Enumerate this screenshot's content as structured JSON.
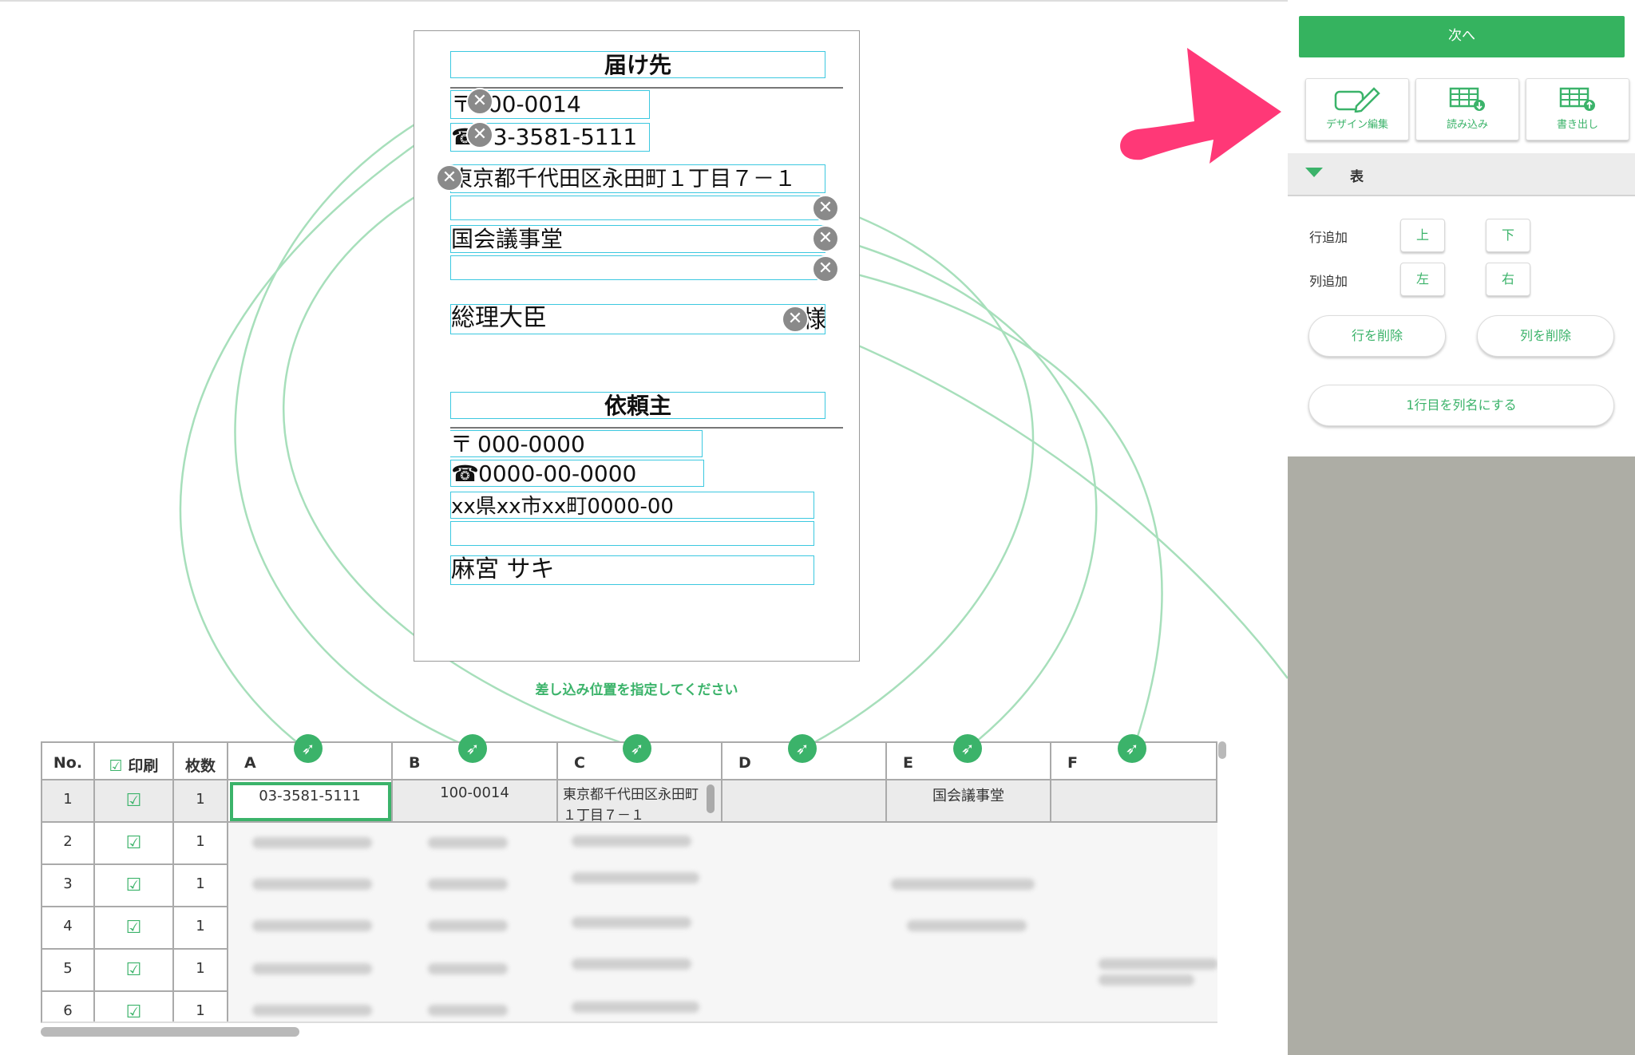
{
  "label": {
    "to_title": "届け先",
    "to_zip": "〒100-0014",
    "to_tel": "☎03-3581-5111",
    "to_address": "東京都千代田区永田町１丁目７－１",
    "to_company": "国会議事堂",
    "to_name": "総理大臣",
    "to_honorific": "様",
    "from_title": "依頼主",
    "from_zip_mark": "〒",
    "from_zip": "000-0000",
    "from_tel_mark": "☎",
    "from_tel": "0000-00-0000",
    "from_address": "xx県xx市xx町0000-00",
    "from_name": "麻宮 サキ"
  },
  "hint": "差し込み位置を指定してください",
  "table": {
    "headers": [
      "No.",
      "印刷",
      "枚数",
      "A",
      "B",
      "C",
      "D",
      "E",
      "F"
    ],
    "rows": [
      {
        "no": "1",
        "count": "1",
        "A": "03-3581-5111",
        "B": "100-0014",
        "C": "東京都千代田区永田町１丁目７－１",
        "E": "国会議事堂"
      },
      {
        "no": "2",
        "count": "1"
      },
      {
        "no": "3",
        "count": "1"
      },
      {
        "no": "4",
        "count": "1"
      },
      {
        "no": "5",
        "count": "1"
      },
      {
        "no": "6",
        "count": "1"
      }
    ]
  },
  "panel": {
    "next": "次へ",
    "tools": [
      "デザイン編集",
      "読み込み",
      "書き出し"
    ],
    "section_title": "表",
    "row_add_label": "行追加",
    "col_add_label": "列追加",
    "up": "上",
    "down": "下",
    "left": "左",
    "right": "右",
    "delete_row": "行を削除",
    "delete_col": "列を削除",
    "header_row": "1行目を列名にする"
  },
  "colors": {
    "accent": "#35b35f",
    "field_border": "#3cc8e0",
    "arrow": "#ff3877",
    "panel_bg": "#adada5"
  },
  "icons": [
    "close-icon",
    "pin-icon",
    "checkbox-icon",
    "design-edit-icon",
    "import-table-icon",
    "export-table-icon",
    "triangle-down-icon",
    "arrow-pointer"
  ]
}
